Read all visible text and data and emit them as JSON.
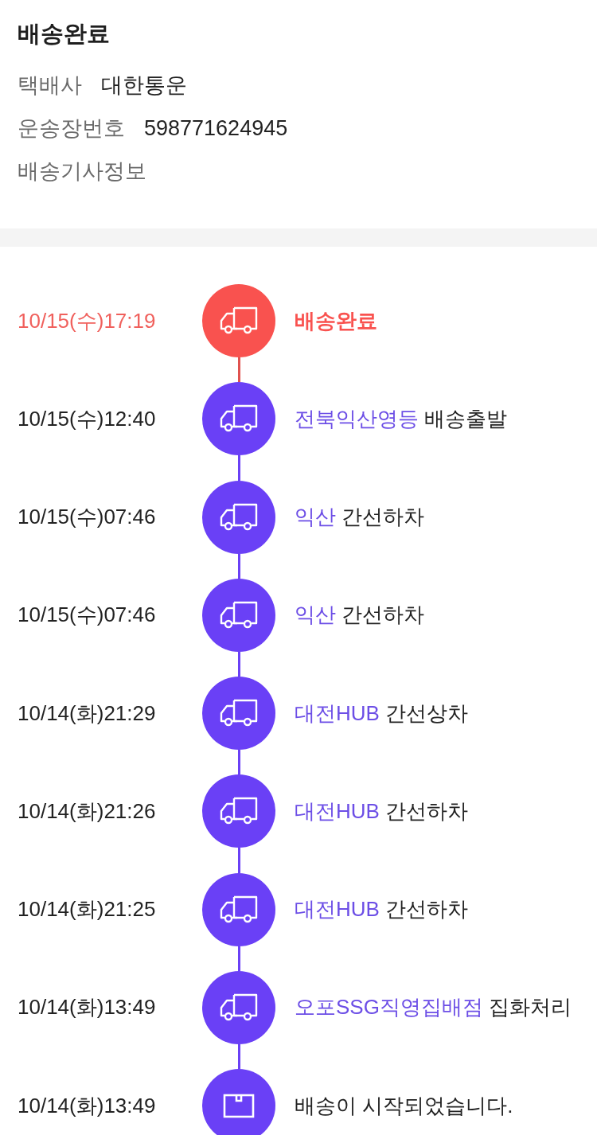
{
  "summary": {
    "title": "배송완료",
    "fields": [
      {
        "label": "택배사",
        "value": "대한통운"
      },
      {
        "label": "운송장번호",
        "value": "598771624945"
      },
      {
        "label": "배송기사정보"
      }
    ]
  },
  "timeline": [
    {
      "time": "10/15(수)17:19",
      "kind": "truck",
      "current": true,
      "event": "배송완료"
    },
    {
      "time": "10/15(수)12:40",
      "kind": "truck",
      "current": false,
      "place": "전북익산영등",
      "event": "배송출발"
    },
    {
      "time": "10/15(수)07:46",
      "kind": "truck",
      "current": false,
      "place": "익산",
      "event": "간선하차"
    },
    {
      "time": "10/15(수)07:46",
      "kind": "truck",
      "current": false,
      "place": "익산",
      "event": "간선하차"
    },
    {
      "time": "10/14(화)21:29",
      "kind": "truck",
      "current": false,
      "place": "대전HUB",
      "event": "간선상차"
    },
    {
      "time": "10/14(화)21:26",
      "kind": "truck",
      "current": false,
      "place": "대전HUB",
      "event": "간선하차"
    },
    {
      "time": "10/14(화)21:25",
      "kind": "truck",
      "current": false,
      "place": "대전HUB",
      "event": "간선하차"
    },
    {
      "time": "10/14(화)13:49",
      "kind": "truck",
      "current": false,
      "place": "오포SSG직영집배점",
      "event": "집화처리"
    },
    {
      "time": "10/14(화)13:49",
      "kind": "box",
      "current": false,
      "event": "배송이 시작되었습니다."
    }
  ]
}
